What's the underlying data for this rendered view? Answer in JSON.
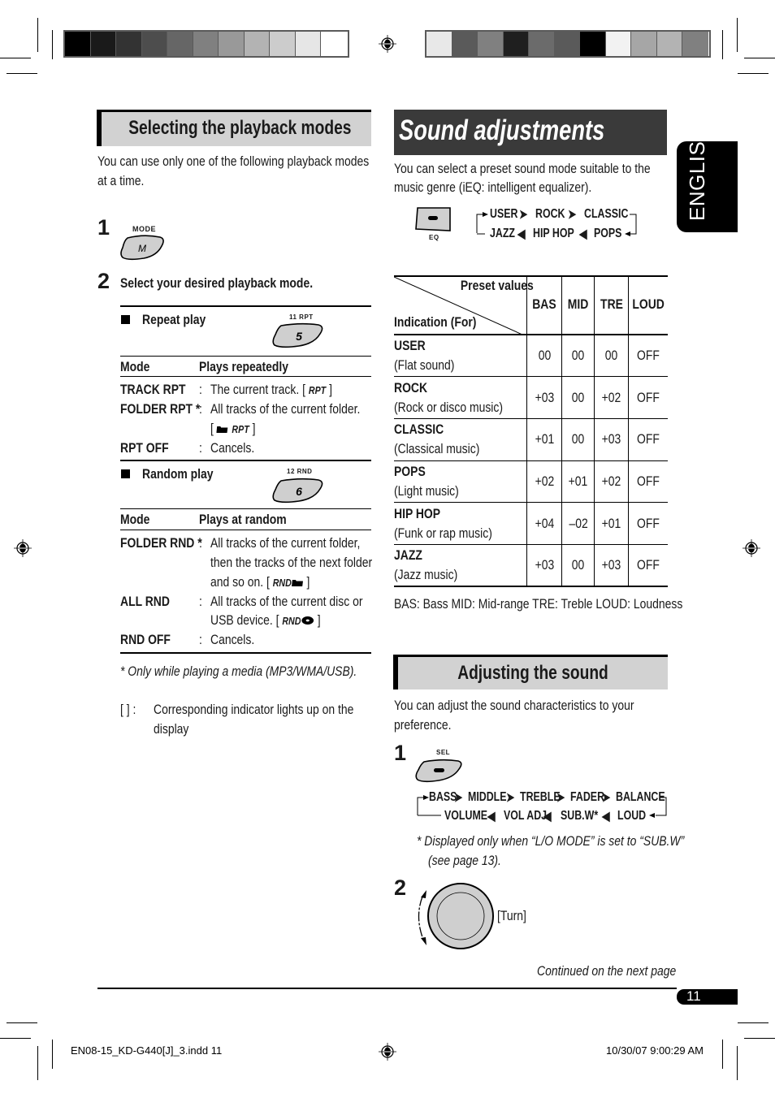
{
  "print_marks": {
    "left_colorbar": [
      "#000000",
      "#1a1a1a",
      "#333333",
      "#4d4d4d",
      "#666666",
      "#808080",
      "#999999",
      "#b3b3b3",
      "#cccccc",
      "#e6e6e6",
      "#ffffff"
    ],
    "right_colorbar": [
      "#e8e8e8",
      "#5a5a5a",
      "#808080",
      "#1f1f1f",
      "#6b6b6b",
      "#5a5a5a",
      "#000000",
      "#f2f2f2",
      "#a6a6a6",
      "#b3b3b3",
      "#808080"
    ],
    "slug_left": "EN08-15_KD-G440[J]_3.indd   11",
    "slug_right": "10/30/07   9:00:29 AM"
  },
  "side_tab": {
    "label": "ENGLISH"
  },
  "playback": {
    "heading": "Selecting the playback modes",
    "intro_line1": "You can use only one of the following playback modes",
    "intro_line2": "at a time.",
    "step1": {
      "num": "1",
      "button_label": "MODE",
      "button_glyph": "M"
    },
    "step2": {
      "num": "2",
      "text": "Select your desired playback mode."
    },
    "repeat": {
      "title": "Repeat play",
      "button_label": "11  RPT",
      "button_glyph": "5",
      "col_mode": "Mode",
      "col_desc": "Plays repeatedly",
      "rows": [
        {
          "mode": "TRACK RPT",
          "desc": "The current track. [",
          "indicator": "RPT",
          "close": " ]"
        },
        {
          "mode": "FOLDER RPT *",
          "desc": "All tracks of the current folder.",
          "desc2_open": "[ ",
          "indicator": "RPT",
          "close": " ]"
        },
        {
          "mode": "RPT OFF",
          "desc": "Cancels."
        }
      ]
    },
    "random": {
      "title": "Random play",
      "button_label": "12  RND",
      "button_glyph": "6",
      "col_mode": "Mode",
      "col_desc": "Plays at random",
      "rows": [
        {
          "mode": "FOLDER RND *",
          "desc": "All tracks of the current folder,",
          "desc2": "then the tracks of the next folder",
          "desc3": "and so on. [",
          "indicator": "RND",
          "close": " ]"
        },
        {
          "mode": "ALL RND",
          "desc": "All tracks of the current disc or",
          "desc2": "USB device. [",
          "indicator": "RND",
          "close": " ]"
        },
        {
          "mode": "RND OFF",
          "desc": "Cancels."
        }
      ]
    },
    "footnote": "*  Only while playing a media (MP3/WMA/USB).",
    "bracket_note_key": "[   ]  :",
    "bracket_note_line1": "Corresponding indicator lights up on the",
    "bracket_note_line2": "display",
    "colon": ":"
  },
  "sound": {
    "heading": "Sound adjustments",
    "intro_line1": "You can select a preset sound mode suitable to the",
    "intro_line2": "music genre (iEQ: intelligent equalizer).",
    "eq_button_label": "EQ",
    "cycle_top": [
      "USER",
      "ROCK",
      "CLASSIC"
    ],
    "cycle_bottom": [
      "JAZZ",
      "HIP HOP",
      "POPS"
    ],
    "table": {
      "corner_top": "Preset values",
      "corner_bottom": "Indication (For)",
      "columns": [
        "BAS",
        "MID",
        "TRE",
        "LOUD"
      ],
      "rows": [
        {
          "name": "USER",
          "desc": "(Flat sound)",
          "values": [
            "00",
            "00",
            "00",
            "OFF"
          ]
        },
        {
          "name": "ROCK",
          "desc": "(Rock or disco music)",
          "values": [
            "+03",
            "00",
            "+02",
            "OFF"
          ]
        },
        {
          "name": "CLASSIC",
          "desc": "(Classical music)",
          "values": [
            "+01",
            "00",
            "+03",
            "OFF"
          ]
        },
        {
          "name": "POPS",
          "desc": "(Light music)",
          "values": [
            "+02",
            "+01",
            "+02",
            "OFF"
          ]
        },
        {
          "name": "HIP HOP",
          "desc": "(Funk or rap music)",
          "values": [
            "+04",
            "–02",
            "+01",
            "OFF"
          ]
        },
        {
          "name": "JAZZ",
          "desc": "(Jazz music)",
          "values": [
            "+03",
            "00",
            "+03",
            "OFF"
          ]
        }
      ]
    },
    "legend": "BAS: Bass  MID: Mid-range  TRE: Treble  LOUD: Loudness"
  },
  "adjusting": {
    "heading": "Adjusting the sound",
    "intro_line1": "You can adjust the sound characteristics to your",
    "intro_line2": "preference.",
    "step1": {
      "num": "1",
      "button_label": "SEL"
    },
    "cycle_top": [
      "BASS",
      "MIDDLE",
      "TREBLE",
      "FADER",
      "BALANCE"
    ],
    "cycle_bottom": [
      "VOLUME",
      "VOL ADJ",
      "SUB.W*",
      "LOUD"
    ],
    "footnote_line1": "*  Displayed only when “L/O MODE” is set to “SUB.W”",
    "footnote_line2": "(see page 13).",
    "step2": {
      "num": "2",
      "action": "[Turn]"
    },
    "continued": "Continued on the next page"
  },
  "page_number": "11"
}
